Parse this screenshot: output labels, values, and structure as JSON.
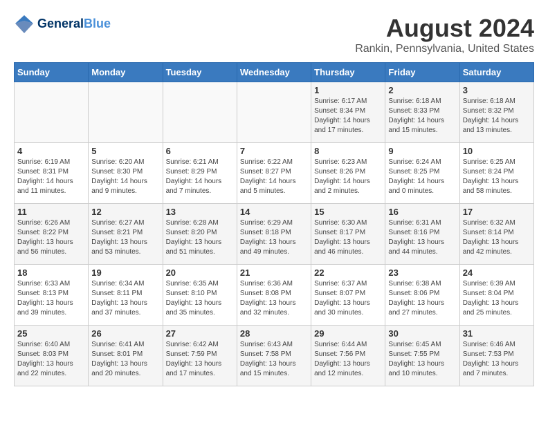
{
  "header": {
    "logo_line1": "General",
    "logo_line2": "Blue",
    "month_year": "August 2024",
    "location": "Rankin, Pennsylvania, United States"
  },
  "weekdays": [
    "Sunday",
    "Monday",
    "Tuesday",
    "Wednesday",
    "Thursday",
    "Friday",
    "Saturday"
  ],
  "weeks": [
    [
      {
        "day": "",
        "info": ""
      },
      {
        "day": "",
        "info": ""
      },
      {
        "day": "",
        "info": ""
      },
      {
        "day": "",
        "info": ""
      },
      {
        "day": "1",
        "info": "Sunrise: 6:17 AM\nSunset: 8:34 PM\nDaylight: 14 hours\nand 17 minutes."
      },
      {
        "day": "2",
        "info": "Sunrise: 6:18 AM\nSunset: 8:33 PM\nDaylight: 14 hours\nand 15 minutes."
      },
      {
        "day": "3",
        "info": "Sunrise: 6:18 AM\nSunset: 8:32 PM\nDaylight: 14 hours\nand 13 minutes."
      }
    ],
    [
      {
        "day": "4",
        "info": "Sunrise: 6:19 AM\nSunset: 8:31 PM\nDaylight: 14 hours\nand 11 minutes."
      },
      {
        "day": "5",
        "info": "Sunrise: 6:20 AM\nSunset: 8:30 PM\nDaylight: 14 hours\nand 9 minutes."
      },
      {
        "day": "6",
        "info": "Sunrise: 6:21 AM\nSunset: 8:29 PM\nDaylight: 14 hours\nand 7 minutes."
      },
      {
        "day": "7",
        "info": "Sunrise: 6:22 AM\nSunset: 8:27 PM\nDaylight: 14 hours\nand 5 minutes."
      },
      {
        "day": "8",
        "info": "Sunrise: 6:23 AM\nSunset: 8:26 PM\nDaylight: 14 hours\nand 2 minutes."
      },
      {
        "day": "9",
        "info": "Sunrise: 6:24 AM\nSunset: 8:25 PM\nDaylight: 14 hours\nand 0 minutes."
      },
      {
        "day": "10",
        "info": "Sunrise: 6:25 AM\nSunset: 8:24 PM\nDaylight: 13 hours\nand 58 minutes."
      }
    ],
    [
      {
        "day": "11",
        "info": "Sunrise: 6:26 AM\nSunset: 8:22 PM\nDaylight: 13 hours\nand 56 minutes."
      },
      {
        "day": "12",
        "info": "Sunrise: 6:27 AM\nSunset: 8:21 PM\nDaylight: 13 hours\nand 53 minutes."
      },
      {
        "day": "13",
        "info": "Sunrise: 6:28 AM\nSunset: 8:20 PM\nDaylight: 13 hours\nand 51 minutes."
      },
      {
        "day": "14",
        "info": "Sunrise: 6:29 AM\nSunset: 8:18 PM\nDaylight: 13 hours\nand 49 minutes."
      },
      {
        "day": "15",
        "info": "Sunrise: 6:30 AM\nSunset: 8:17 PM\nDaylight: 13 hours\nand 46 minutes."
      },
      {
        "day": "16",
        "info": "Sunrise: 6:31 AM\nSunset: 8:16 PM\nDaylight: 13 hours\nand 44 minutes."
      },
      {
        "day": "17",
        "info": "Sunrise: 6:32 AM\nSunset: 8:14 PM\nDaylight: 13 hours\nand 42 minutes."
      }
    ],
    [
      {
        "day": "18",
        "info": "Sunrise: 6:33 AM\nSunset: 8:13 PM\nDaylight: 13 hours\nand 39 minutes."
      },
      {
        "day": "19",
        "info": "Sunrise: 6:34 AM\nSunset: 8:11 PM\nDaylight: 13 hours\nand 37 minutes."
      },
      {
        "day": "20",
        "info": "Sunrise: 6:35 AM\nSunset: 8:10 PM\nDaylight: 13 hours\nand 35 minutes."
      },
      {
        "day": "21",
        "info": "Sunrise: 6:36 AM\nSunset: 8:08 PM\nDaylight: 13 hours\nand 32 minutes."
      },
      {
        "day": "22",
        "info": "Sunrise: 6:37 AM\nSunset: 8:07 PM\nDaylight: 13 hours\nand 30 minutes."
      },
      {
        "day": "23",
        "info": "Sunrise: 6:38 AM\nSunset: 8:06 PM\nDaylight: 13 hours\nand 27 minutes."
      },
      {
        "day": "24",
        "info": "Sunrise: 6:39 AM\nSunset: 8:04 PM\nDaylight: 13 hours\nand 25 minutes."
      }
    ],
    [
      {
        "day": "25",
        "info": "Sunrise: 6:40 AM\nSunset: 8:03 PM\nDaylight: 13 hours\nand 22 minutes."
      },
      {
        "day": "26",
        "info": "Sunrise: 6:41 AM\nSunset: 8:01 PM\nDaylight: 13 hours\nand 20 minutes."
      },
      {
        "day": "27",
        "info": "Sunrise: 6:42 AM\nSunset: 7:59 PM\nDaylight: 13 hours\nand 17 minutes."
      },
      {
        "day": "28",
        "info": "Sunrise: 6:43 AM\nSunset: 7:58 PM\nDaylight: 13 hours\nand 15 minutes."
      },
      {
        "day": "29",
        "info": "Sunrise: 6:44 AM\nSunset: 7:56 PM\nDaylight: 13 hours\nand 12 minutes."
      },
      {
        "day": "30",
        "info": "Sunrise: 6:45 AM\nSunset: 7:55 PM\nDaylight: 13 hours\nand 10 minutes."
      },
      {
        "day": "31",
        "info": "Sunrise: 6:46 AM\nSunset: 7:53 PM\nDaylight: 13 hours\nand 7 minutes."
      }
    ]
  ]
}
